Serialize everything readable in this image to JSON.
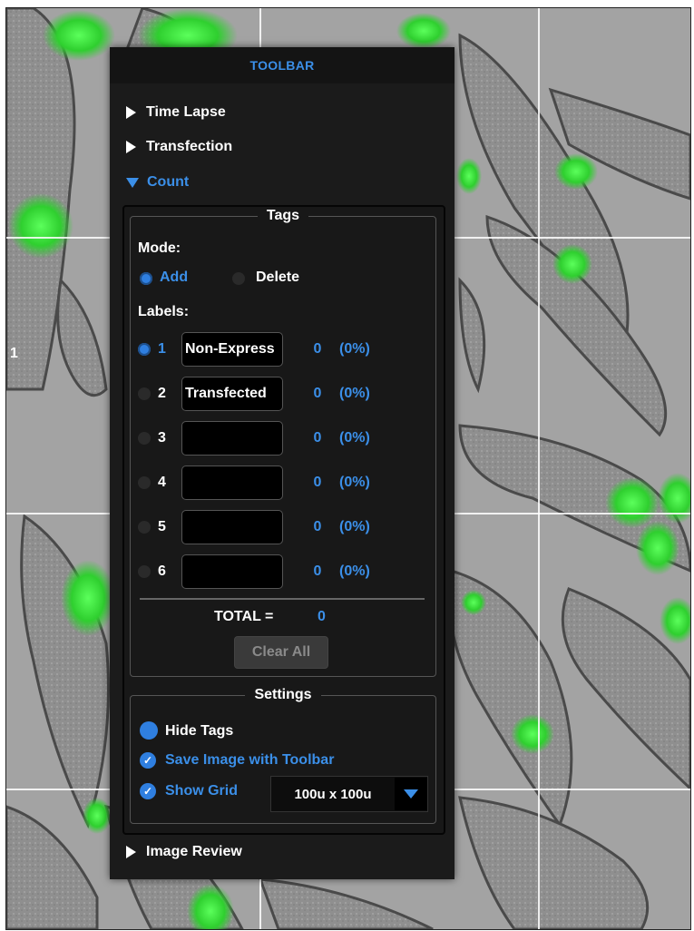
{
  "toolbar": {
    "title": "TOOLBAR",
    "sections": {
      "time_lapse": "Time Lapse",
      "transfection": "Transfection",
      "count": "Count",
      "image_review": "Image Review"
    }
  },
  "image": {
    "edge_label": "1"
  },
  "tags": {
    "title": "Tags",
    "mode_label": "Mode:",
    "mode_add": "Add",
    "mode_delete": "Delete",
    "mode_selected": "Add",
    "labels_label": "Labels:",
    "labels": [
      {
        "num": "1",
        "name": "Non-Express",
        "count": "0",
        "pct": "(0%)",
        "selected": true
      },
      {
        "num": "2",
        "name": "Transfected",
        "count": "0",
        "pct": "(0%)",
        "selected": false
      },
      {
        "num": "3",
        "name": "",
        "count": "0",
        "pct": "(0%)",
        "selected": false
      },
      {
        "num": "4",
        "name": "",
        "count": "0",
        "pct": "(0%)",
        "selected": false
      },
      {
        "num": "5",
        "name": "",
        "count": "0",
        "pct": "(0%)",
        "selected": false
      },
      {
        "num": "6",
        "name": "",
        "count": "0",
        "pct": "(0%)",
        "selected": false
      }
    ],
    "total_label": "TOTAL =",
    "total_value": "0",
    "clear_all": "Clear All"
  },
  "settings": {
    "title": "Settings",
    "hide_tags": "Hide Tags",
    "save_image": "Save Image with Toolbar",
    "show_grid": "Show Grid",
    "grid_size": "100u x 100u"
  },
  "colors": {
    "accent": "#3b8fe8",
    "panel": "#1b1b1b",
    "cell_green": "#3fd93f"
  }
}
